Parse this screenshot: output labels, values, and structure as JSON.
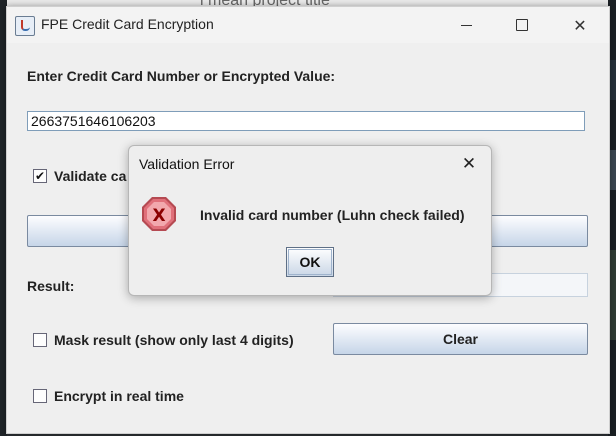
{
  "background": {
    "title_fragment": "i mean project title"
  },
  "window": {
    "title": "FPE Credit Card Encryption",
    "close_glyph": "✕"
  },
  "form": {
    "input_label": "Enter Credit Card Number or Encrypted Value:",
    "input_value": "2663751646106203",
    "validate_label": "Validate ca",
    "validate_checked": true,
    "result_label": "Result:",
    "mask_label": "Mask result (show only last 4 digits)",
    "mask_checked": false,
    "clear_label": "Clear",
    "realtime_label": "Encrypt in real time",
    "realtime_checked": false
  },
  "dialog": {
    "title": "Validation Error",
    "close_glyph": "✕",
    "message": "Invalid card number (Luhn check failed)",
    "ok_label": "OK",
    "icon": "error-icon"
  },
  "colors": {
    "error_icon_fill": "#e0707a",
    "error_x": "#8b0000",
    "button_gradient_bottom": "#c6d5e8"
  }
}
